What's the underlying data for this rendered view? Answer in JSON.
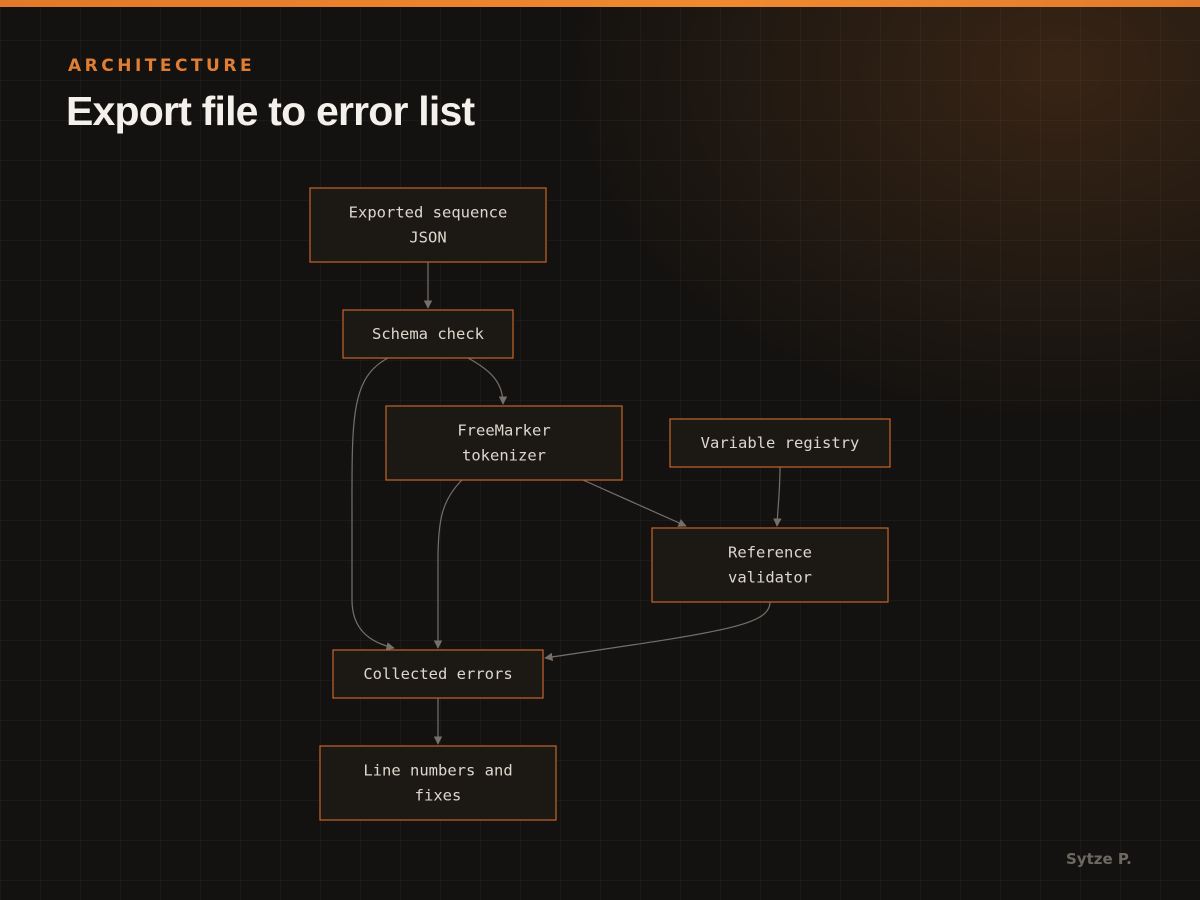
{
  "header": {
    "eyebrow": "ARCHITECTURE",
    "title": "Export file to error list"
  },
  "footer": {
    "author": "Sytze P."
  },
  "colors": {
    "accent": "#e07f34",
    "node_border": "#c4642a",
    "edge": "#77706a",
    "background": "#141210"
  },
  "diagram": {
    "nodes": [
      {
        "id": "exported-json",
        "lines": [
          "Exported sequence",
          "JSON"
        ]
      },
      {
        "id": "schema-check",
        "lines": [
          "Schema check"
        ]
      },
      {
        "id": "freemarker-tokenizer",
        "lines": [
          "FreeMarker",
          "tokenizer"
        ]
      },
      {
        "id": "variable-registry",
        "lines": [
          "Variable registry"
        ]
      },
      {
        "id": "reference-validator",
        "lines": [
          "Reference",
          "validator"
        ]
      },
      {
        "id": "collected-errors",
        "lines": [
          "Collected errors"
        ]
      },
      {
        "id": "line-numbers-fixes",
        "lines": [
          "Line numbers and",
          "fixes"
        ]
      }
    ],
    "edges": [
      {
        "from": "exported-json",
        "to": "schema-check"
      },
      {
        "from": "schema-check",
        "to": "freemarker-tokenizer"
      },
      {
        "from": "schema-check",
        "to": "collected-errors"
      },
      {
        "from": "freemarker-tokenizer",
        "to": "reference-validator"
      },
      {
        "from": "freemarker-tokenizer",
        "to": "collected-errors"
      },
      {
        "from": "variable-registry",
        "to": "reference-validator"
      },
      {
        "from": "reference-validator",
        "to": "collected-errors"
      },
      {
        "from": "collected-errors",
        "to": "line-numbers-fixes"
      }
    ]
  }
}
